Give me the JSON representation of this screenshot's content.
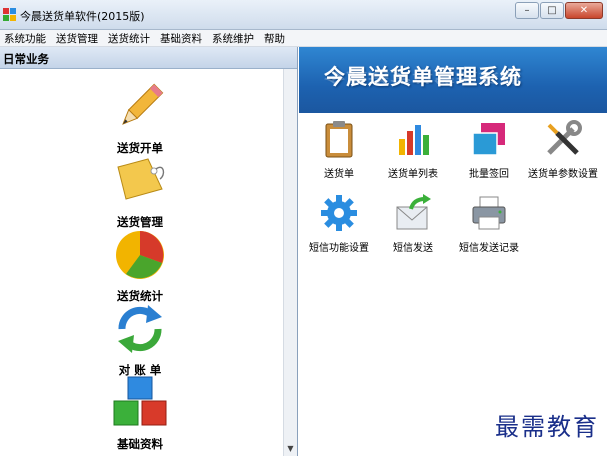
{
  "window": {
    "title": "今晨送货单软件(2015版)"
  },
  "menu": [
    "系统功能",
    "送货管理",
    "送货统计",
    "基础资料",
    "系统维护",
    "帮助"
  ],
  "left_panel": {
    "header": "日常业务",
    "items": [
      {
        "label": "送货开单",
        "icon": "pencil-icon"
      },
      {
        "label": "送货管理",
        "icon": "tag-icon"
      },
      {
        "label": "送货统计",
        "icon": "pie-chart-icon"
      },
      {
        "label": "对 账 单",
        "icon": "refresh-arrows-icon"
      },
      {
        "label": "基础资料",
        "icon": "blocks-icon"
      }
    ]
  },
  "banner": {
    "title": "今晨送货单管理系统"
  },
  "tools": [
    {
      "label": "送货单",
      "icon": "clipboard-icon"
    },
    {
      "label": "送货单列表",
      "icon": "bar-chart-icon"
    },
    {
      "label": "批量签回",
      "icon": "cards-icon"
    },
    {
      "label": "送货单参数设置",
      "icon": "wrench-screwdriver-icon"
    },
    {
      "label": "短信功能设置",
      "icon": "gear-icon"
    },
    {
      "label": "短信发送",
      "icon": "envelope-send-icon"
    },
    {
      "label": "短信发送记录",
      "icon": "printer-icon"
    }
  ],
  "watermark": "最需教育",
  "colors": {
    "banner": "#1d62b0",
    "panel_header": "#c4d4e8",
    "watermark": "#1a2f8a"
  }
}
